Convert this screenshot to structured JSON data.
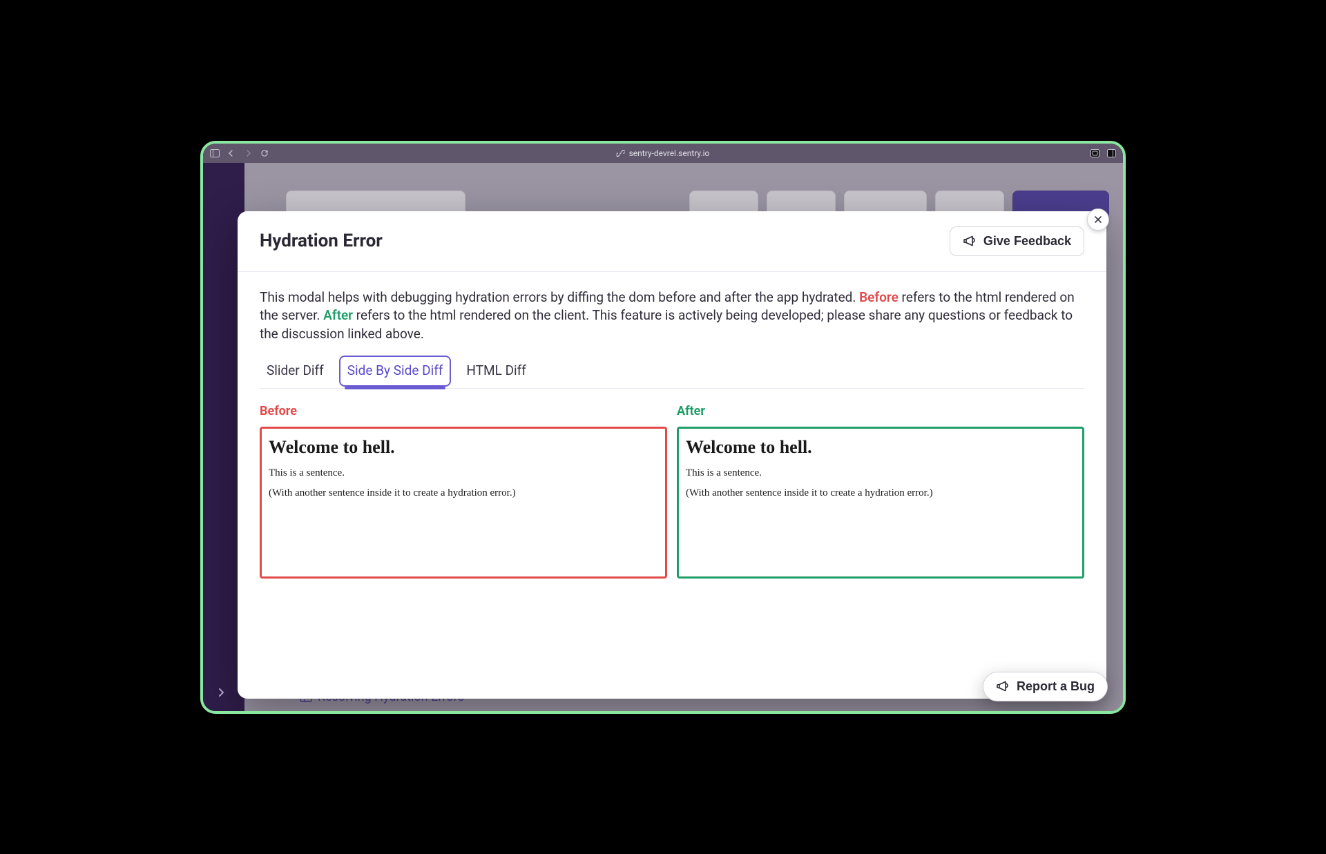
{
  "browser": {
    "url": "sentry-devrel.sentry.io"
  },
  "background": {
    "bottom_link": "Resolving Hydration Errors"
  },
  "modal": {
    "title": "Hydration Error",
    "feedback_label": "Give Feedback",
    "close_label": "Close",
    "description": {
      "part1": "This modal helps with debugging hydration errors by diffing the dom before and after the app hydrated. ",
      "before_word": "Before",
      "part2": " refers to the html rendered on the server. ",
      "after_word": "After",
      "part3": " refers to the html rendered on the client. This feature is actively being developed; please share any questions or feedback to the discussion linked above."
    },
    "tabs": {
      "slider": "Slider Diff",
      "side_by_side": "Side By Side Diff",
      "html": "HTML Diff"
    },
    "diff": {
      "before_label": "Before",
      "after_label": "After",
      "before": {
        "heading": "Welcome to hell.",
        "line1": "This is a sentence.",
        "line2": "(With another sentence inside it to create a hydration error.)"
      },
      "after": {
        "heading": "Welcome to hell.",
        "line1": "This is a sentence.",
        "line2": "(With another sentence inside it to create a hydration error.)"
      }
    }
  },
  "bug_button": "Report a Bug"
}
